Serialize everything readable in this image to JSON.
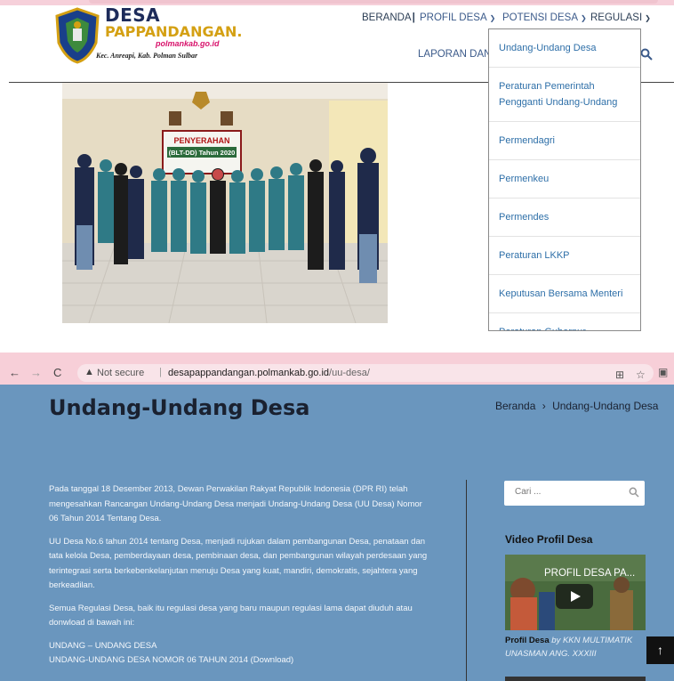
{
  "site": {
    "name_line1": "DESA",
    "name_line2": "PAPPANDANGAN.",
    "url": "polmankab.go.id",
    "location": "Kec. Anreapi, Kab. Polman Sulbar"
  },
  "nav": {
    "beranda": "BERANDA",
    "profil_desa": "PROFIL DESA",
    "potensi_desa": "POTENSI DESA",
    "regulasi": "REGULASI",
    "laporan_dana": "LAPORAN DANA"
  },
  "dropdown": {
    "items": [
      "Undang-Undang Desa",
      "Peraturan Pemerintah Pengganti Undang-Undang",
      "Permendagri",
      "Permenkeu",
      "Permendes",
      "Peraturan LKKP",
      "Keputusan Bersama Menteri",
      "Peraturan Gubernur"
    ]
  },
  "photo": {
    "banner_title": "PENYERAHAN",
    "banner_sub": "(BLT-DD) Tahun 2020"
  },
  "browser": {
    "not_secure": "Not secure",
    "domain": "desapappandangan.polmankab.go.id",
    "path": "/uu-desa/"
  },
  "page": {
    "title": "Undang-Undang Desa",
    "breadcrumb_home": "Beranda",
    "breadcrumb_sep": "›",
    "breadcrumb_current": "Undang-Undang Desa",
    "paragraphs": [
      "Pada tanggal 18 Desember 2013, Dewan Perwakilan Rakyat Republik Indonesia (DPR RI) telah mengesahkan Rancangan Undang-Undang Desa menjadi Undang-Undang Desa (UU Desa) Nomor 06 Tahun 2014 Tentang Desa.",
      "UU Desa No.6 tahun 2014 tentang Desa, menjadi rujukan dalam pembangunan Desa, penataan dan tata kelola Desa, pemberdayaan desa, pembinaan desa, dan pembangunan wilayah perdesaan yang terintegrasi serta berkebenkelanjutan menuju Desa yang kuat, mandiri, demokratis, sejahtera yang berkeadilan.",
      "Semua Regulasi Desa, baik itu regulasi desa yang baru maupun regulasi lama dapat diuduh atau donwload di bawah ini:",
      "UNDANG – UNDANG DESA",
      "UNDANG-UNDANG DESA NOMOR 06 TAHUN 2014 (Download)"
    ]
  },
  "sidebar": {
    "search_placeholder": "Cari ...",
    "video_heading": "Video Profil Desa",
    "video_title": "PROFIL DESA PA...",
    "video_caption_bold": "Profil Desa",
    "video_caption_rest": "by KKN MULTIMATIK UNASMAN ANG. XXXIII"
  },
  "colors": {
    "page_bg": "#6a96be",
    "accent_yellow": "#d4a013",
    "nav_blue": "#3b5a8a",
    "link_blue": "#2e6fa8",
    "browser_bar": "#f7cfd8"
  }
}
